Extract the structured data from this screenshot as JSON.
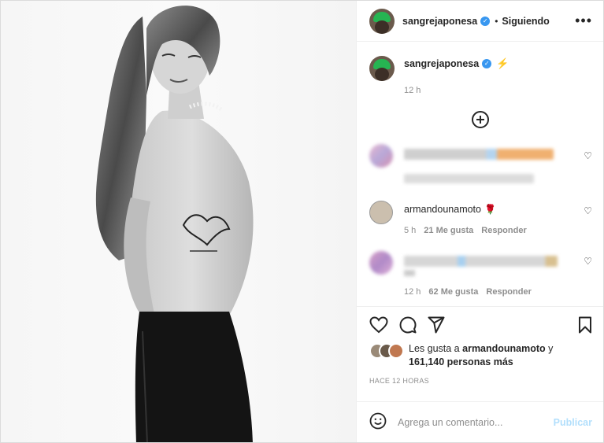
{
  "post": {
    "author": "sangrejaponesa",
    "follow_status": "Siguiendo",
    "separator": "•",
    "more_icon": "more-horizontal-icon"
  },
  "caption": {
    "username": "sangrejaponesa",
    "emoji": "⚡",
    "time": "12 h"
  },
  "comments": [
    {
      "username": "armandounamoto",
      "emoji": "🌹",
      "time": "5 h",
      "likes": "21 Me gusta",
      "reply_label": "Responder"
    },
    {
      "time": "12 h",
      "likes": "62 Me gusta",
      "reply_label": "Responder"
    }
  ],
  "likes": {
    "prefix": "Les gusta a",
    "user": "armandounamoto",
    "connector": "y",
    "others": "161,140 personas más"
  },
  "posted_ago": "HACE 12 HORAS",
  "composer": {
    "placeholder": "Agrega un comentario...",
    "publish_label": "Publicar"
  },
  "colors": {
    "verified": "#3897f0",
    "publish_disabled": "#b2dffc",
    "muted": "#8e8e8e"
  }
}
